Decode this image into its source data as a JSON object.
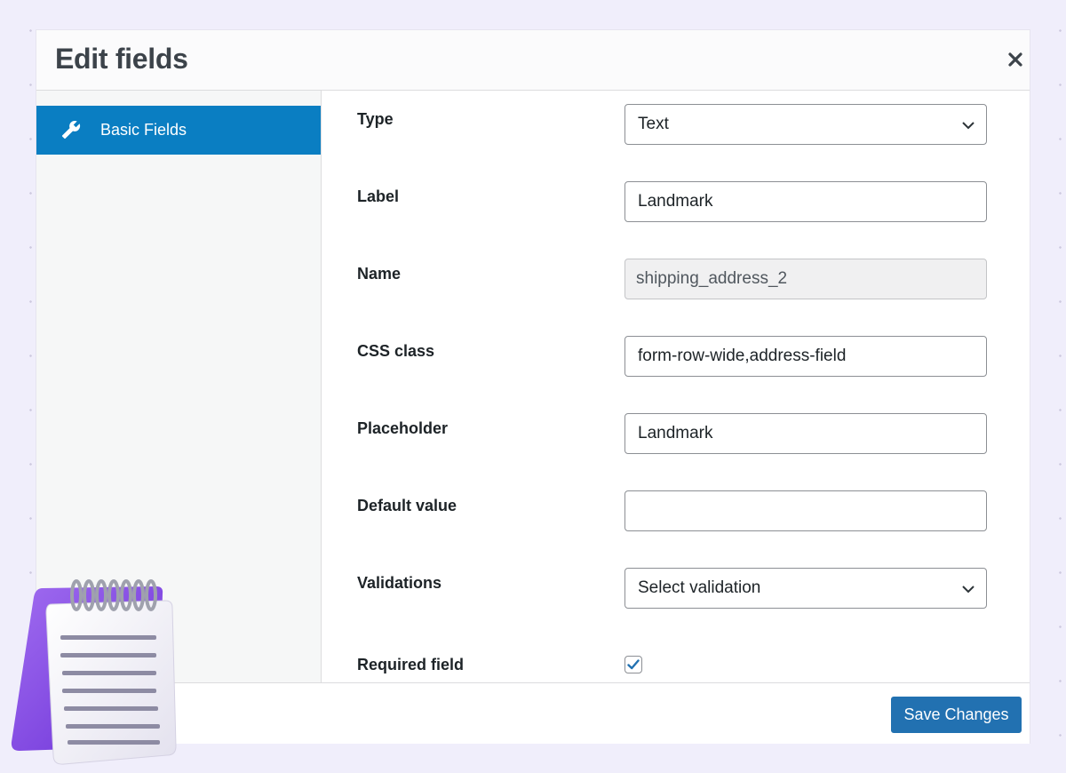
{
  "modal": {
    "title": "Edit fields",
    "close_icon": "close-icon"
  },
  "sidebar": {
    "items": [
      {
        "label": "Basic Fields",
        "icon": "wrench-icon",
        "active": true
      }
    ]
  },
  "form": {
    "type": {
      "label": "Type",
      "value": "Text"
    },
    "label": {
      "label": "Label",
      "value": "Landmark"
    },
    "name": {
      "label": "Name",
      "value": "shipping_address_2"
    },
    "css_class": {
      "label": "CSS class",
      "value": "form-row-wide,address-field"
    },
    "placeholder": {
      "label": "Placeholder",
      "value": "Landmark"
    },
    "default_value": {
      "label": "Default value",
      "value": ""
    },
    "validations": {
      "label": "Validations",
      "value": "Select validation"
    },
    "required": {
      "label": "Required field",
      "checked": true
    }
  },
  "footer": {
    "save_label": "Save Changes"
  },
  "colors": {
    "accent": "#0a7ec2",
    "button": "#2271b1",
    "background": "#f0eefb"
  }
}
